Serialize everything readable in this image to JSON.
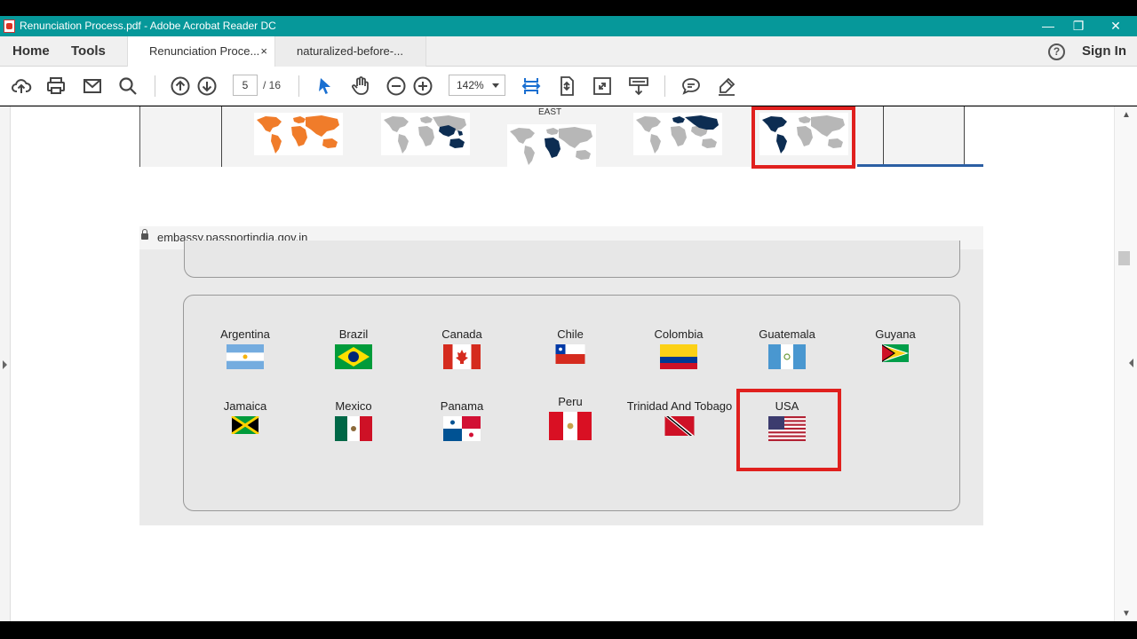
{
  "window": {
    "title": "Renunciation Process.pdf - Adobe Acrobat Reader DC",
    "controls": [
      "minimize",
      "restore",
      "close"
    ]
  },
  "nav": {
    "home": "Home",
    "tools": "Tools",
    "sign_in": "Sign In"
  },
  "tabs": [
    {
      "label": "Renunciation Proce...",
      "active": true,
      "close": "×"
    },
    {
      "label": "naturalized-before-...",
      "active": false
    }
  ],
  "toolbar": {
    "page_current": "5",
    "page_total": "/ 16",
    "zoom": "142%"
  },
  "page": {
    "map_label": "EAST",
    "url": "embassy.passportindia.gov.in",
    "countries_row1": [
      "Argentina",
      "Brazil",
      "Canada",
      "Chile",
      "Colombia",
      "Guatemala",
      "Guyana"
    ],
    "countries_row2": [
      "Jamaica",
      "Mexico",
      "Panama",
      "Peru",
      "Trinidad And Tobago",
      "USA"
    ]
  },
  "colors": {
    "titlebar": "#06989a",
    "highlight": "#e0201e",
    "map_orange": "#f07c2a",
    "map_blue": "#0d2d52"
  }
}
